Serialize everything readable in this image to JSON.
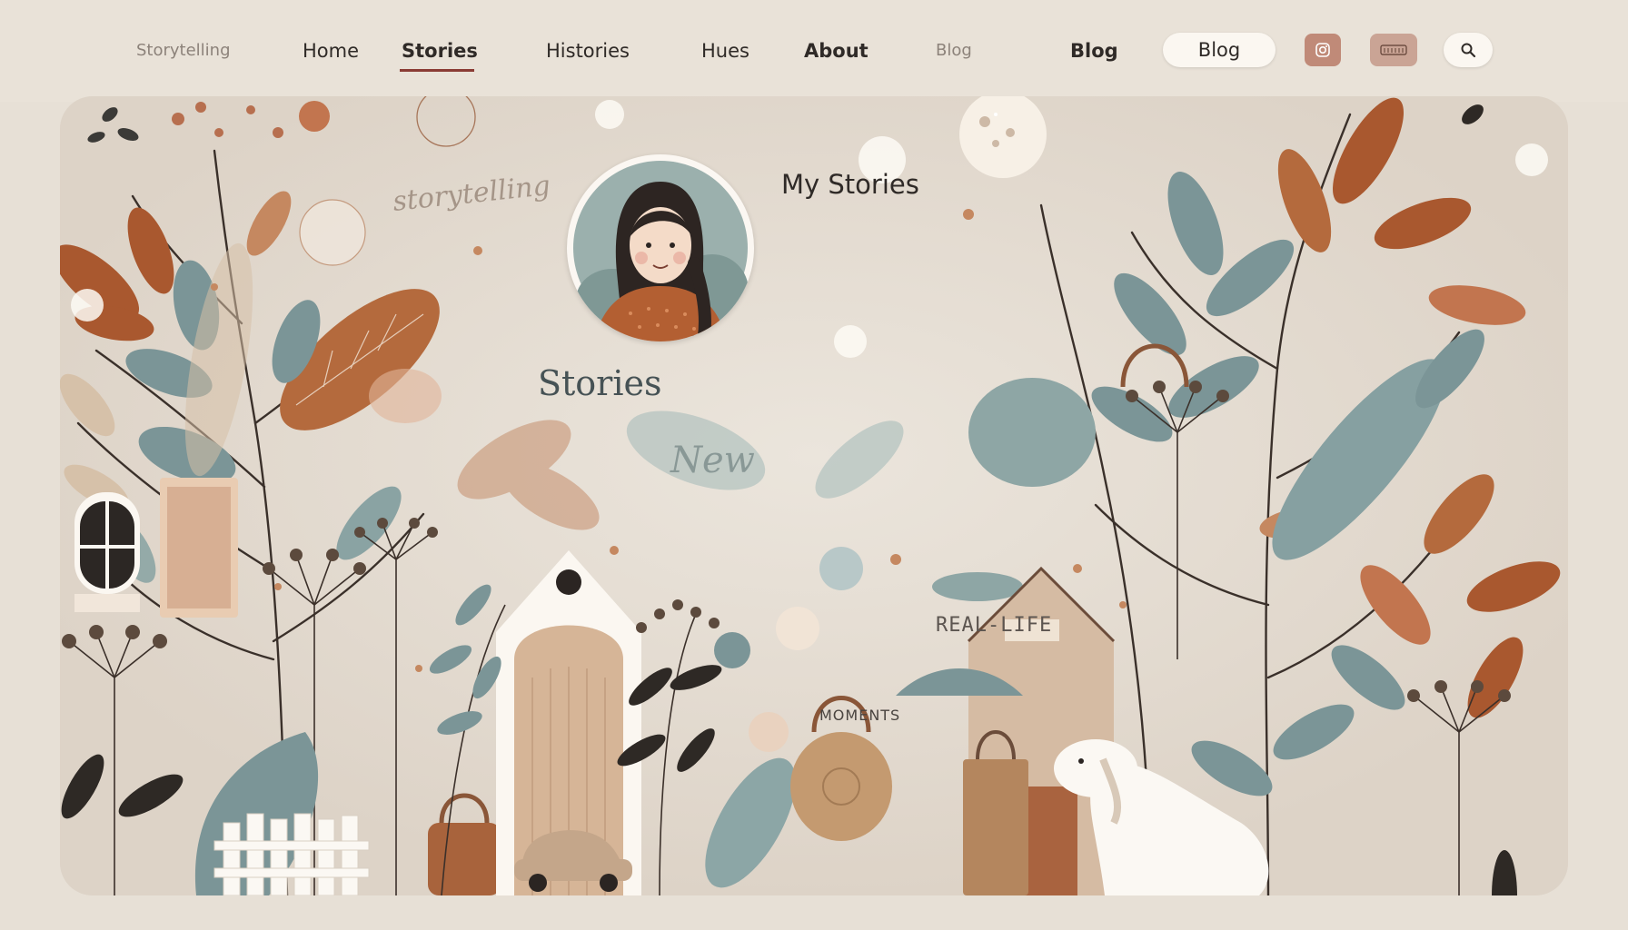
{
  "nav": {
    "brand": "Storytelling",
    "items": [
      {
        "label": "Home"
      },
      {
        "label": "Stories",
        "active": true
      },
      {
        "label": "Histories"
      },
      {
        "label": "Hues"
      },
      {
        "label": "About"
      },
      {
        "label": "Blog"
      }
    ],
    "blog_label": "Blog",
    "blog_pill_label": "Blog",
    "icons": [
      "instagram-icon",
      "linkedin-icon",
      "search-icon"
    ],
    "active_underline_color": "#8a3b34"
  },
  "hero": {
    "profile_title": "My Stories",
    "stories_label": "Stories",
    "handwritten_title": "storytelling",
    "handwritten_new": "New",
    "real_life_label": "REAL-LIFE",
    "moments_label": "MOMENTS"
  },
  "palette": {
    "background": "#e7e0d6",
    "rust": "#b9643f",
    "terracotta": "#c9825a",
    "slate_teal": "#7b9597",
    "sand": "#d6bfa6",
    "ink": "#2f2a27"
  }
}
